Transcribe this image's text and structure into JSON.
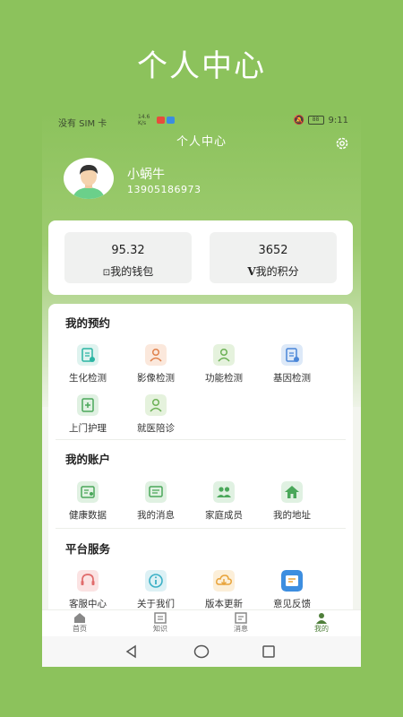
{
  "promo": {
    "title": "个人中心"
  },
  "statusbar": {
    "carrier": "没有 SIM 卡",
    "speed_top": "14.6",
    "speed_bottom": "K/s",
    "battery": "88",
    "time": "9:11"
  },
  "header": {
    "title": "个人中心"
  },
  "user": {
    "name": "小蜗牛",
    "phone": "13905186973"
  },
  "wallet": {
    "balance": "95.32",
    "label": "我的钱包",
    "icon": "wallet-icon"
  },
  "points": {
    "value": "3652",
    "label": "我的积分",
    "icon": "v-points-icon"
  },
  "appointments": {
    "title": "我的预约",
    "items": [
      {
        "label": "生化检测",
        "icon": "biochem-icon",
        "color": "#2bb5a3"
      },
      {
        "label": "影像检测",
        "icon": "imaging-icon",
        "color": "#e0824d"
      },
      {
        "label": "功能检测",
        "icon": "function-icon",
        "color": "#6db156"
      },
      {
        "label": "基因检测",
        "icon": "gene-icon",
        "color": "#4a86d8"
      },
      {
        "label": "上门护理",
        "icon": "home-nursing-icon",
        "color": "#4aa75a"
      },
      {
        "label": "就医陪诊",
        "icon": "escort-icon",
        "color": "#6db156"
      }
    ]
  },
  "account": {
    "title": "我的账户",
    "items": [
      {
        "label": "健康数据",
        "icon": "health-data-icon",
        "color": "#4aa75a"
      },
      {
        "label": "我的消息",
        "icon": "message-icon",
        "color": "#4aa75a"
      },
      {
        "label": "家庭成员",
        "icon": "family-icon",
        "color": "#4aa75a"
      },
      {
        "label": "我的地址",
        "icon": "address-home-icon",
        "color": "#4aa75a"
      }
    ]
  },
  "services": {
    "title": "平台服务",
    "items": [
      {
        "label": "客服中心",
        "icon": "headset-icon",
        "color": "#e06b6b"
      },
      {
        "label": "关于我们",
        "icon": "info-icon",
        "color": "#3bb0c6"
      },
      {
        "label": "版本更新",
        "icon": "cloud-download-icon",
        "color": "#e8a33a"
      },
      {
        "label": "意见反馈",
        "icon": "feedback-icon",
        "color": "#3d8ee0"
      }
    ]
  },
  "tabs": [
    {
      "label": "首页",
      "icon": "home-icon"
    },
    {
      "label": "知识",
      "icon": "knowledge-icon"
    },
    {
      "label": "消息",
      "icon": "news-icon"
    },
    {
      "label": "我的",
      "icon": "profile-icon",
      "active": true
    }
  ],
  "colors": {
    "brand": "#8cc25c",
    "active_tab": "#4f7f3a"
  }
}
